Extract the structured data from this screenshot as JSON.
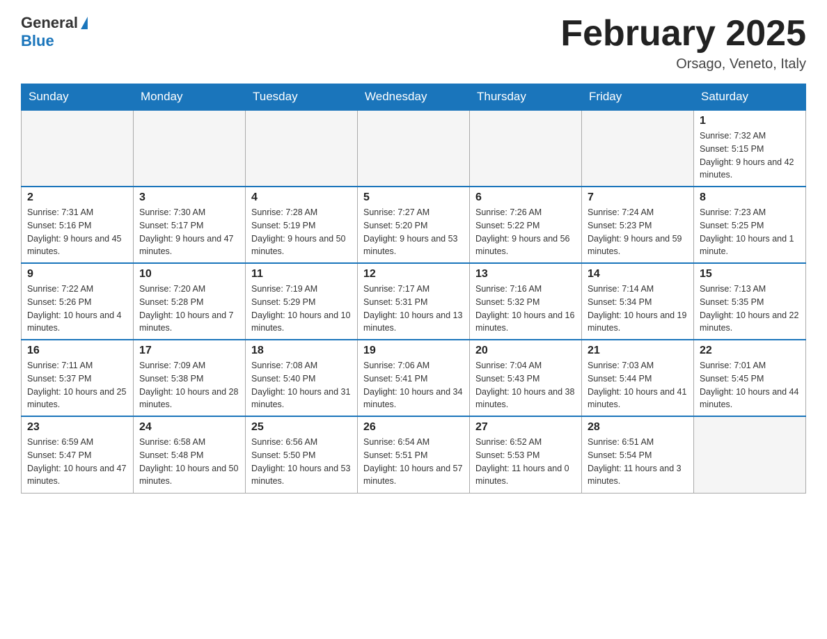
{
  "header": {
    "logo_general": "General",
    "logo_blue": "Blue",
    "month_title": "February 2025",
    "location": "Orsago, Veneto, Italy"
  },
  "weekdays": [
    "Sunday",
    "Monday",
    "Tuesday",
    "Wednesday",
    "Thursday",
    "Friday",
    "Saturday"
  ],
  "weeks": [
    [
      {
        "day": "",
        "empty": true
      },
      {
        "day": "",
        "empty": true
      },
      {
        "day": "",
        "empty": true
      },
      {
        "day": "",
        "empty": true
      },
      {
        "day": "",
        "empty": true
      },
      {
        "day": "",
        "empty": true
      },
      {
        "day": "1",
        "sunrise": "7:32 AM",
        "sunset": "5:15 PM",
        "daylight": "9 hours and 42 minutes."
      }
    ],
    [
      {
        "day": "2",
        "sunrise": "7:31 AM",
        "sunset": "5:16 PM",
        "daylight": "9 hours and 45 minutes."
      },
      {
        "day": "3",
        "sunrise": "7:30 AM",
        "sunset": "5:17 PM",
        "daylight": "9 hours and 47 minutes."
      },
      {
        "day": "4",
        "sunrise": "7:28 AM",
        "sunset": "5:19 PM",
        "daylight": "9 hours and 50 minutes."
      },
      {
        "day": "5",
        "sunrise": "7:27 AM",
        "sunset": "5:20 PM",
        "daylight": "9 hours and 53 minutes."
      },
      {
        "day": "6",
        "sunrise": "7:26 AM",
        "sunset": "5:22 PM",
        "daylight": "9 hours and 56 minutes."
      },
      {
        "day": "7",
        "sunrise": "7:24 AM",
        "sunset": "5:23 PM",
        "daylight": "9 hours and 59 minutes."
      },
      {
        "day": "8",
        "sunrise": "7:23 AM",
        "sunset": "5:25 PM",
        "daylight": "10 hours and 1 minute."
      }
    ],
    [
      {
        "day": "9",
        "sunrise": "7:22 AM",
        "sunset": "5:26 PM",
        "daylight": "10 hours and 4 minutes."
      },
      {
        "day": "10",
        "sunrise": "7:20 AM",
        "sunset": "5:28 PM",
        "daylight": "10 hours and 7 minutes."
      },
      {
        "day": "11",
        "sunrise": "7:19 AM",
        "sunset": "5:29 PM",
        "daylight": "10 hours and 10 minutes."
      },
      {
        "day": "12",
        "sunrise": "7:17 AM",
        "sunset": "5:31 PM",
        "daylight": "10 hours and 13 minutes."
      },
      {
        "day": "13",
        "sunrise": "7:16 AM",
        "sunset": "5:32 PM",
        "daylight": "10 hours and 16 minutes."
      },
      {
        "day": "14",
        "sunrise": "7:14 AM",
        "sunset": "5:34 PM",
        "daylight": "10 hours and 19 minutes."
      },
      {
        "day": "15",
        "sunrise": "7:13 AM",
        "sunset": "5:35 PM",
        "daylight": "10 hours and 22 minutes."
      }
    ],
    [
      {
        "day": "16",
        "sunrise": "7:11 AM",
        "sunset": "5:37 PM",
        "daylight": "10 hours and 25 minutes."
      },
      {
        "day": "17",
        "sunrise": "7:09 AM",
        "sunset": "5:38 PM",
        "daylight": "10 hours and 28 minutes."
      },
      {
        "day": "18",
        "sunrise": "7:08 AM",
        "sunset": "5:40 PM",
        "daylight": "10 hours and 31 minutes."
      },
      {
        "day": "19",
        "sunrise": "7:06 AM",
        "sunset": "5:41 PM",
        "daylight": "10 hours and 34 minutes."
      },
      {
        "day": "20",
        "sunrise": "7:04 AM",
        "sunset": "5:43 PM",
        "daylight": "10 hours and 38 minutes."
      },
      {
        "day": "21",
        "sunrise": "7:03 AM",
        "sunset": "5:44 PM",
        "daylight": "10 hours and 41 minutes."
      },
      {
        "day": "22",
        "sunrise": "7:01 AM",
        "sunset": "5:45 PM",
        "daylight": "10 hours and 44 minutes."
      }
    ],
    [
      {
        "day": "23",
        "sunrise": "6:59 AM",
        "sunset": "5:47 PM",
        "daylight": "10 hours and 47 minutes."
      },
      {
        "day": "24",
        "sunrise": "6:58 AM",
        "sunset": "5:48 PM",
        "daylight": "10 hours and 50 minutes."
      },
      {
        "day": "25",
        "sunrise": "6:56 AM",
        "sunset": "5:50 PM",
        "daylight": "10 hours and 53 minutes."
      },
      {
        "day": "26",
        "sunrise": "6:54 AM",
        "sunset": "5:51 PM",
        "daylight": "10 hours and 57 minutes."
      },
      {
        "day": "27",
        "sunrise": "6:52 AM",
        "sunset": "5:53 PM",
        "daylight": "11 hours and 0 minutes."
      },
      {
        "day": "28",
        "sunrise": "6:51 AM",
        "sunset": "5:54 PM",
        "daylight": "11 hours and 3 minutes."
      },
      {
        "day": "",
        "empty": true
      }
    ]
  ]
}
